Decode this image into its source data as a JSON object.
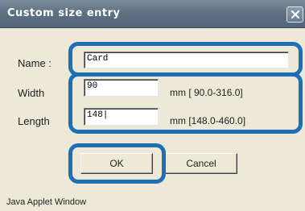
{
  "window": {
    "title": "Custom size entry",
    "status": "Java Applet Window"
  },
  "form": {
    "name_label": "Name :",
    "name_value": "Card",
    "width_label": "Width",
    "width_value": "90",
    "width_range": "mm [ 90.0-316.0]",
    "length_label": "Length",
    "length_value": "148|",
    "length_range": "mm [148.0-460.0]"
  },
  "buttons": {
    "ok_label": "OK",
    "cancel_label": "Cancel"
  },
  "colors": {
    "highlight": "#1f6fb5",
    "titlebar": "#5f7183",
    "dialog_bg": "#ece9d8"
  },
  "icons": {
    "close": "close-icon"
  }
}
